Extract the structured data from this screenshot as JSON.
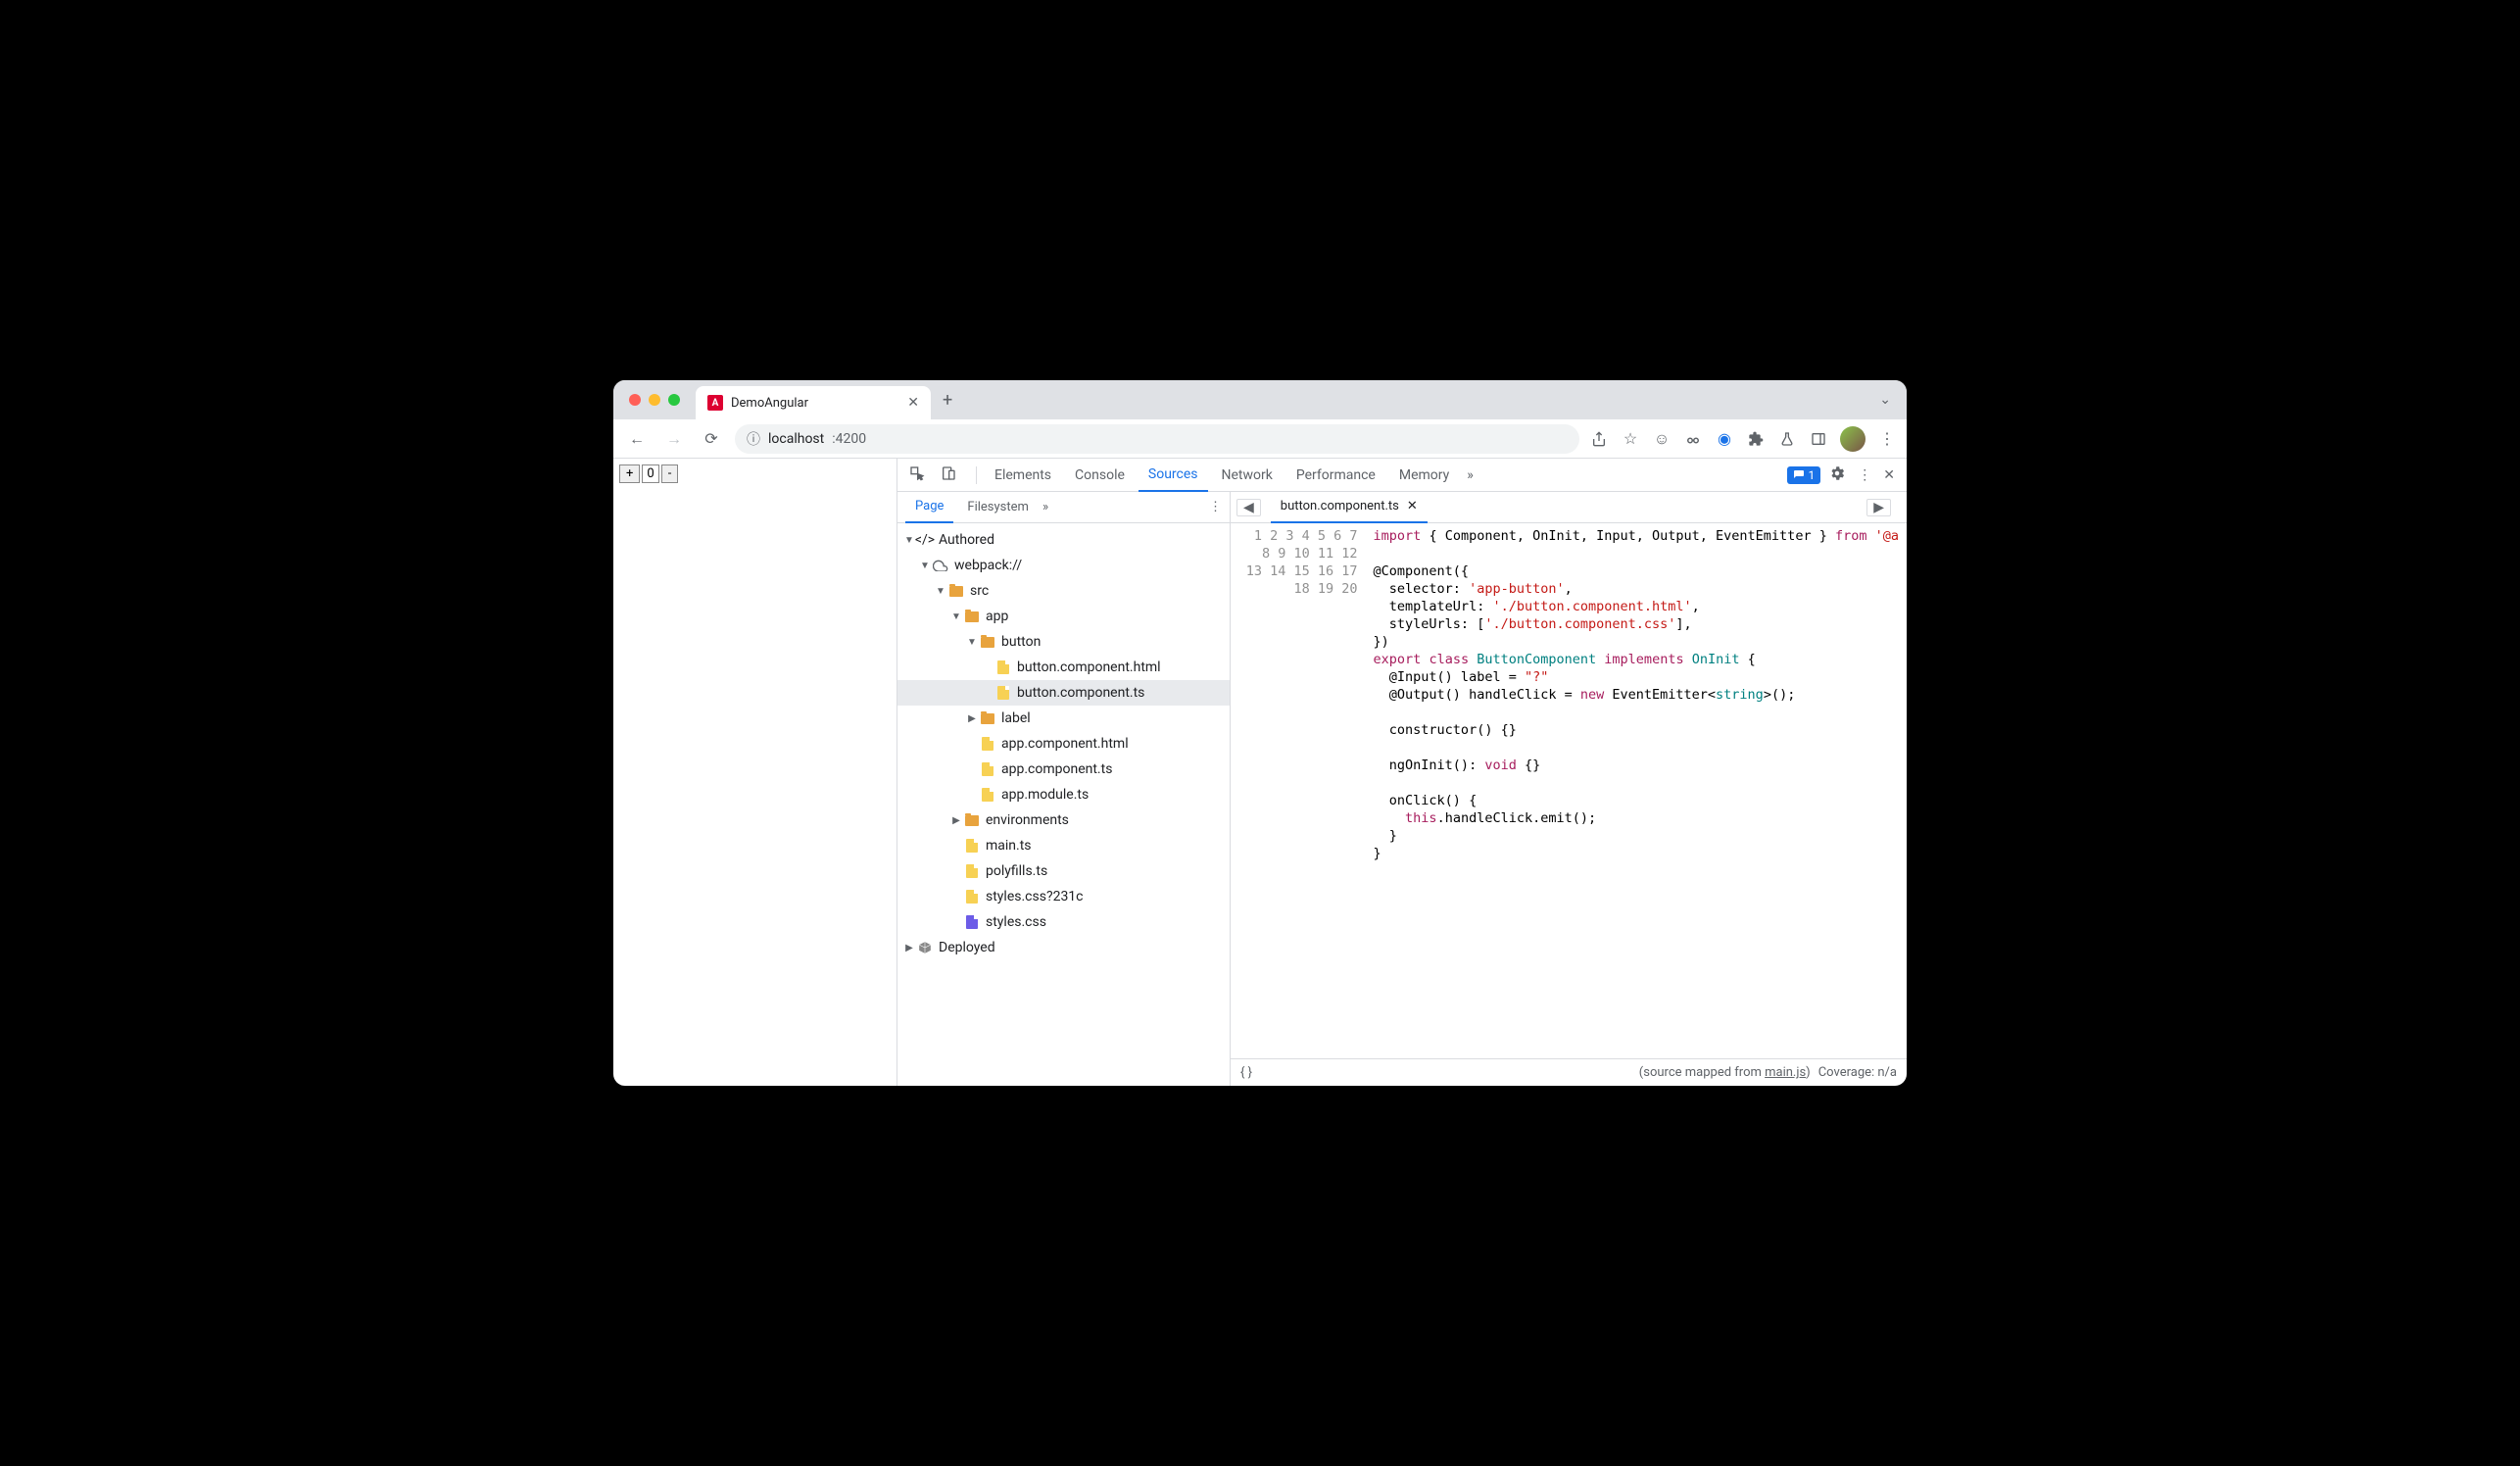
{
  "browser": {
    "tab_title": "DemoAngular",
    "url_host": "localhost",
    "url_port": ":4200"
  },
  "page": {
    "plus": "+",
    "count": "0",
    "minus": "-"
  },
  "devtools": {
    "panels": [
      "Elements",
      "Console",
      "Sources",
      "Network",
      "Performance",
      "Memory"
    ],
    "active_panel": "Sources",
    "issues_count": "1",
    "sources": {
      "nav_tabs": [
        "Page",
        "Filesystem"
      ],
      "active_nav": "Page",
      "tree": {
        "authored": "Authored",
        "webpack": "webpack://",
        "src": "src",
        "app": "app",
        "button": "button",
        "button_html": "button.component.html",
        "button_ts": "button.component.ts",
        "label": "label",
        "app_html": "app.component.html",
        "app_ts": "app.component.ts",
        "app_module": "app.module.ts",
        "environments": "environments",
        "main_ts": "main.ts",
        "polyfills": "polyfills.ts",
        "styles_q": "styles.css?231c",
        "styles": "styles.css",
        "deployed": "Deployed"
      },
      "open_file": "button.component.ts",
      "code_lines": 20,
      "status_prefix": "(source mapped from ",
      "status_link": "main.js",
      "status_suffix": ")",
      "coverage": "Coverage: n/a"
    }
  }
}
